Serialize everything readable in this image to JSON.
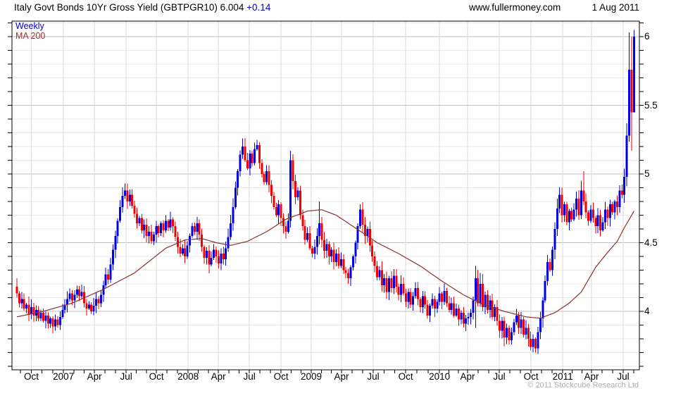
{
  "header": {
    "title": "Italy Govt Bonds 10Yr Gross Yield (GBTPGR10) 6.004",
    "change": "+0.14",
    "site": "www.fullermoney.com",
    "date": "1 Aug 2011"
  },
  "legend": {
    "series": "Weekly",
    "ma": "MA 200"
  },
  "footer": {
    "copyright": "© 2011 Stockcube Research Ltd"
  },
  "colors": {
    "up": "#0000e8",
    "down": "#f40000",
    "ma_line": "#8e2f2f",
    "legend_series": "#0000cc",
    "legend_ma": "#993333",
    "change_text": "#0000cc",
    "grid_minor": "#e7e7e7",
    "grid_major": "#bfbfbf",
    "grid_vertical": "#dadada",
    "frame": "#000000",
    "copyright_text": "#adadad"
  },
  "chart_data": {
    "type": "candlestick",
    "period": "Weekly",
    "title": "Italy Govt Bonds 10Yr Gross Yield",
    "ticker": "GBTPGR10",
    "last": 6.004,
    "change": 0.14,
    "overlay": "MA 200",
    "ylim": [
      3.57,
      6.11
    ],
    "y_major_step": 0.5,
    "y_minor_step": 0.1,
    "grid": true,
    "y_ticks": [
      {
        "value": 6,
        "label": "6"
      },
      {
        "value": 5.5,
        "label": "5.5"
      },
      {
        "value": 5,
        "label": "5"
      },
      {
        "value": 4.5,
        "label": "4.5"
      },
      {
        "value": 4,
        "label": "4"
      }
    ],
    "x_labels": [
      {
        "label": "Oct",
        "week": 6
      },
      {
        "label": "2007",
        "week": 19.4
      },
      {
        "label": "Apr",
        "week": 32.3
      },
      {
        "label": "Jul",
        "week": 45.5
      },
      {
        "label": "Oct",
        "week": 58.1
      },
      {
        "label": "2008",
        "week": 71.3
      },
      {
        "label": "Apr",
        "week": 83.9
      },
      {
        "label": "Jul",
        "week": 96.8
      },
      {
        "label": "Oct",
        "week": 110
      },
      {
        "label": "2009",
        "week": 122.6
      },
      {
        "label": "Apr",
        "week": 135.2
      },
      {
        "label": "Jul",
        "week": 148.4
      },
      {
        "label": "Oct",
        "week": 161.9
      },
      {
        "label": "2010",
        "week": 176
      },
      {
        "label": "Apr",
        "week": 187.7
      },
      {
        "label": "Jul",
        "week": 200.9
      },
      {
        "label": "Oct",
        "week": 214.1
      },
      {
        "label": "2011",
        "week": 227.3
      },
      {
        "label": "Apr",
        "week": 239.3
      },
      {
        "label": "Jul",
        "week": 252.5
      }
    ],
    "first_open": 4.18,
    "weekly_closes": [
      4.13,
      4.06,
      4.09,
      4.02,
      4.05,
      3.98,
      4.03,
      3.97,
      4.01,
      3.95,
      3.99,
      3.93,
      3.97,
      3.91,
      3.95,
      3.89,
      3.94,
      3.9,
      3.96,
      4.01,
      4.05,
      4.09,
      4.13,
      4.08,
      4.12,
      4.16,
      4.11,
      4.14,
      4.06,
      4.02,
      4.05,
      4.0,
      4.04,
      4.09,
      4.06,
      4.12,
      4.19,
      4.27,
      4.23,
      4.34,
      4.45,
      4.55,
      4.66,
      4.76,
      4.84,
      4.88,
      4.8,
      4.85,
      4.77,
      4.71,
      4.64,
      4.68,
      4.59,
      4.63,
      4.55,
      4.58,
      4.51,
      4.56,
      4.62,
      4.57,
      4.64,
      4.59,
      4.66,
      4.61,
      4.67,
      4.62,
      4.54,
      4.47,
      4.42,
      4.46,
      4.4,
      4.48,
      4.55,
      4.62,
      4.58,
      4.64,
      4.56,
      4.47,
      4.39,
      4.44,
      4.34,
      4.39,
      4.45,
      4.4,
      4.35,
      4.42,
      4.38,
      4.46,
      4.54,
      4.64,
      4.76,
      4.9,
      5.02,
      5.14,
      5.2,
      5.1,
      5.04,
      5.15,
      5.08,
      5.18,
      5.21,
      5.08,
      5.0,
      4.94,
      5.02,
      4.92,
      4.84,
      4.76,
      4.7,
      4.78,
      4.68,
      4.62,
      4.58,
      4.66,
      5.1,
      4.95,
      4.83,
      4.88,
      4.7,
      4.62,
      4.52,
      4.57,
      4.46,
      4.42,
      4.47,
      4.55,
      4.64,
      4.52,
      4.44,
      4.49,
      4.4,
      4.45,
      4.36,
      4.42,
      4.33,
      4.38,
      4.3,
      4.28,
      4.24,
      4.32,
      4.4,
      4.5,
      4.62,
      4.74,
      4.63,
      4.55,
      4.6,
      4.48,
      4.4,
      4.33,
      4.25,
      4.3,
      4.19,
      4.24,
      4.14,
      4.24,
      4.17,
      4.26,
      4.18,
      4.12,
      4.2,
      4.13,
      4.07,
      4.14,
      4.05,
      4.11,
      4.17,
      4.09,
      4.03,
      4.11,
      4.05,
      3.97,
      4.04,
      4.09,
      4.02,
      4.07,
      4.13,
      4.07,
      4.15,
      4.06,
      4.01,
      4.06,
      3.97,
      4.02,
      3.94,
      3.99,
      3.91,
      3.95,
      3.96,
      3.99,
      4.08,
      4.24,
      4.06,
      4.2,
      4.03,
      4.12,
      4.01,
      4.08,
      3.96,
      4.03,
      3.93,
      3.86,
      3.93,
      3.81,
      3.88,
      3.79,
      3.85,
      3.92,
      3.97,
      3.88,
      3.94,
      3.83,
      3.88,
      3.8,
      3.74,
      3.8,
      3.73,
      3.85,
      3.95,
      4.08,
      4.22,
      4.36,
      4.3,
      4.45,
      4.6,
      4.75,
      4.85,
      4.7,
      4.78,
      4.65,
      4.73,
      4.67,
      4.74,
      4.82,
      4.7,
      4.88,
      4.8,
      4.72,
      4.66,
      4.74,
      4.68,
      4.62,
      4.7,
      4.59,
      4.65,
      4.74,
      4.68,
      4.78,
      4.72,
      4.8,
      4.76,
      4.88,
      4.85,
      4.98,
      5.28,
      5.76,
      5.45,
      6.0
    ],
    "wick_overrides": {
      "15": {
        "l": 3.84
      },
      "45": {
        "h": 4.93
      },
      "94": {
        "h": 5.26
      },
      "100": {
        "h": 5.25
      },
      "114": {
        "h": 5.17
      },
      "126": {
        "h": 4.8
      },
      "143": {
        "h": 4.78
      },
      "191": {
        "h": 4.33,
        "l": 3.88
      },
      "193": {
        "h": 4.28
      },
      "216": {
        "l": 3.7
      },
      "236": {
        "h": 5.02
      },
      "254": {
        "h": 5.37
      },
      "255": {
        "h": 6.03
      },
      "256": {
        "h": 6.0,
        "l": 5.17
      },
      "257": {
        "h": 6.05,
        "l": 5.72
      }
    },
    "ma200_anchors": [
      [
        0,
        3.96
      ],
      [
        11,
        4.0
      ],
      [
        23,
        4.06
      ],
      [
        36,
        4.16
      ],
      [
        49,
        4.28
      ],
      [
        62,
        4.46
      ],
      [
        70,
        4.52
      ],
      [
        77,
        4.53
      ],
      [
        83,
        4.5
      ],
      [
        89,
        4.48
      ],
      [
        96,
        4.51
      ],
      [
        104,
        4.58
      ],
      [
        112,
        4.67
      ],
      [
        121,
        4.73
      ],
      [
        127,
        4.74
      ],
      [
        133,
        4.7
      ],
      [
        139,
        4.63
      ],
      [
        145,
        4.56
      ],
      [
        150,
        4.5
      ],
      [
        159,
        4.42
      ],
      [
        168,
        4.33
      ],
      [
        177,
        4.22
      ],
      [
        186,
        4.12
      ],
      [
        194,
        4.05
      ],
      [
        203,
        4.0
      ],
      [
        212,
        3.96
      ],
      [
        218,
        3.95
      ],
      [
        224,
        3.99
      ],
      [
        230,
        4.06
      ],
      [
        235,
        4.14
      ],
      [
        241,
        4.32
      ],
      [
        246,
        4.43
      ],
      [
        250,
        4.51
      ],
      [
        253,
        4.61
      ],
      [
        257,
        4.73
      ]
    ]
  }
}
